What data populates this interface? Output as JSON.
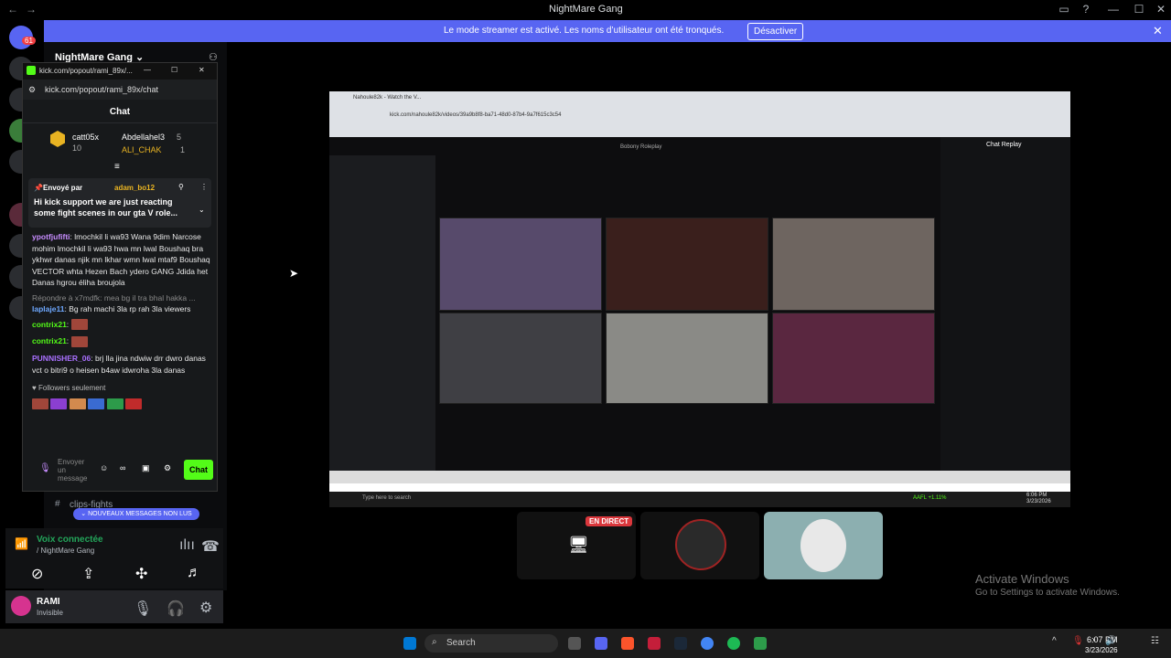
{
  "window": {
    "title": "NightMare Gang"
  },
  "banner": {
    "message": "Le mode streamer est activé. Les noms d’utilisateur ont été tronqués.",
    "button": "Désactiver"
  },
  "server": {
    "name": "NightMare Gang",
    "badge_count": "61"
  },
  "popout": {
    "window_title": "kick.com/popout/rami_89x/...",
    "url": "kick.com/popout/rami_89x/chat",
    "header": "Chat",
    "leaderboard": [
      {
        "name": "catt05x",
        "count": "10"
      },
      {
        "name": "Abdellahel3",
        "count": "5"
      },
      {
        "name": "ALI_CHAK",
        "count": "1"
      }
    ],
    "pinned": {
      "label": "Envoyé par",
      "user": "adam_bo12",
      "text": "Hi kick support we are just reacting some fight scenes in our gta V role..."
    },
    "messages": [
      {
        "user": "ypotfjufifti",
        "text": "lmochkil li wa93 Wana 9dim Narcose mohim lmochkil li wa93 hwa mn lwal Boushaq bra ykhwr danas njik mn lkhar wmn lwal mtaf9 Boushaq VECTOR whta Hezen Bach ydero GANG Jdida het Danas hgrou éliha broujola"
      },
      {
        "reply": "Répondre à x7mdfk: mea bg il tra bhal hakka ..."
      },
      {
        "user": "laplaje11",
        "text": "Bg rah machi 3la rp rah 3la viewers"
      },
      {
        "user": "contrix21",
        "text": ""
      },
      {
        "user": "contrix21",
        "text": ""
      },
      {
        "user": "PUNNISHER_06",
        "text": "brj lla jina ndwiw drr dwro danas vct o bitri9 o heisen b4aw idwroha 3la danas"
      }
    ],
    "followers_only": "Followers seulement",
    "input_placeholder": "Envoyer un message",
    "chat_button": "Chat"
  },
  "channel": {
    "name": "clips-fights",
    "unread": "NOUVEAUX MESSAGES NON LUS"
  },
  "voice": {
    "status": "Voix connectée",
    "location": "/ NightMare Gang"
  },
  "user": {
    "name": "RAMI",
    "status": "Invisible"
  },
  "stream": {
    "tab_title": "Nahoule82k - Watch the V...",
    "url": "kick.com/nahoule82k/videos/39a9b8f8-ba71-48d0-87b4-9a7f615c3c54",
    "replay_title": "Chat Replay",
    "game_title": "Bobony Roleplay",
    "taskbar_search": "Type here to search",
    "aafl": "AAFL +1.11%",
    "time": "6:06 PM",
    "date": "3/23/2026"
  },
  "live_badge": "EN DIRECT",
  "windows": {
    "activate_title": "Activate Windows",
    "activate_sub": "Go to Settings to activate Windows.",
    "search": "Search",
    "time": "6:07 PM",
    "date": "3/23/2026"
  }
}
